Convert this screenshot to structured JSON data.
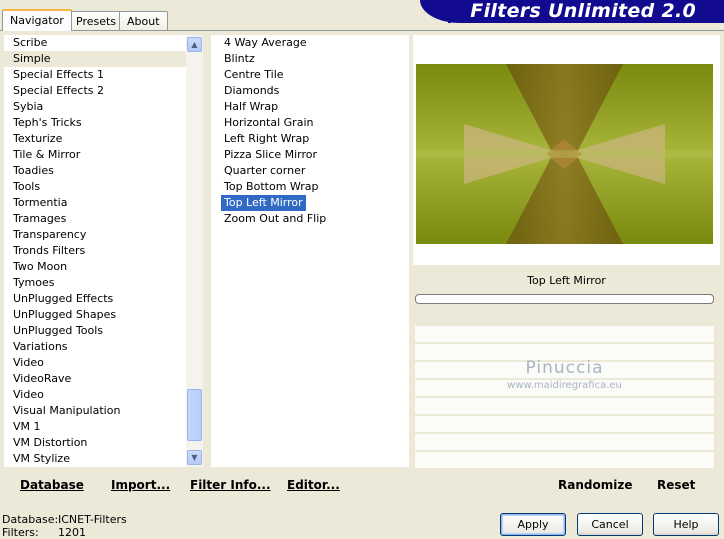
{
  "app_title": "Filters Unlimited 2.0",
  "tabs": [
    {
      "label": "Navigator",
      "active": true
    },
    {
      "label": "Presets",
      "active": false
    },
    {
      "label": "About",
      "active": false
    }
  ],
  "categories": [
    "Scribe",
    "Simple",
    "Special Effects 1",
    "Special Effects 2",
    "Sybia",
    "Teph's Tricks",
    "Texturize",
    "Tile & Mirror",
    "Toadies",
    "Tools",
    "Tormentia",
    "Tramages",
    "Transparency",
    "Tronds Filters",
    "Two Moon",
    "Tymoes",
    "UnPlugged Effects",
    "UnPlugged Shapes",
    "UnPlugged Tools",
    "Variations",
    "Video",
    "VideoRave",
    "Video",
    "Visual Manipulation",
    "VM 1",
    "VM Distortion",
    "VM Stylize"
  ],
  "selected_category": "Simple",
  "filters": [
    "4 Way Average",
    "Blintz",
    "Centre Tile",
    "Diamonds",
    "Half Wrap",
    "Horizontal Grain",
    "Left Right Wrap",
    "Pizza Slice Mirror",
    "Quarter corner",
    "Top Bottom Wrap",
    "Top Left Mirror",
    "Zoom Out and Flip"
  ],
  "selected_filter": "Top Left Mirror",
  "preview": {
    "filter_name": "Top Left Mirror",
    "watermark_name": "Pinuccia",
    "watermark_url": "www.maidiregrafica.eu",
    "colors": {
      "olive": "#7a8c10",
      "bright": "#9ab01c",
      "dark": "#5a4f0c",
      "tan": "#c8b27c"
    }
  },
  "buttons": {
    "database": "Database",
    "import": "Import...",
    "filter_info": "Filter Info...",
    "editor": "Editor...",
    "randomize": "Randomize",
    "reset": "Reset",
    "apply": "Apply",
    "cancel": "Cancel",
    "help": "Help"
  },
  "status": {
    "database_label": "Database:",
    "database_value": "ICNET-Filters",
    "filters_label": "Filters:",
    "filters_value": "1201"
  },
  "colors": {
    "window_bg": "#ece9d8",
    "title_bar": "#120a8f",
    "selection": "#316ac5"
  },
  "icons": {
    "scroll_up": "chevron-up-icon",
    "scroll_down": "chevron-down-icon"
  }
}
